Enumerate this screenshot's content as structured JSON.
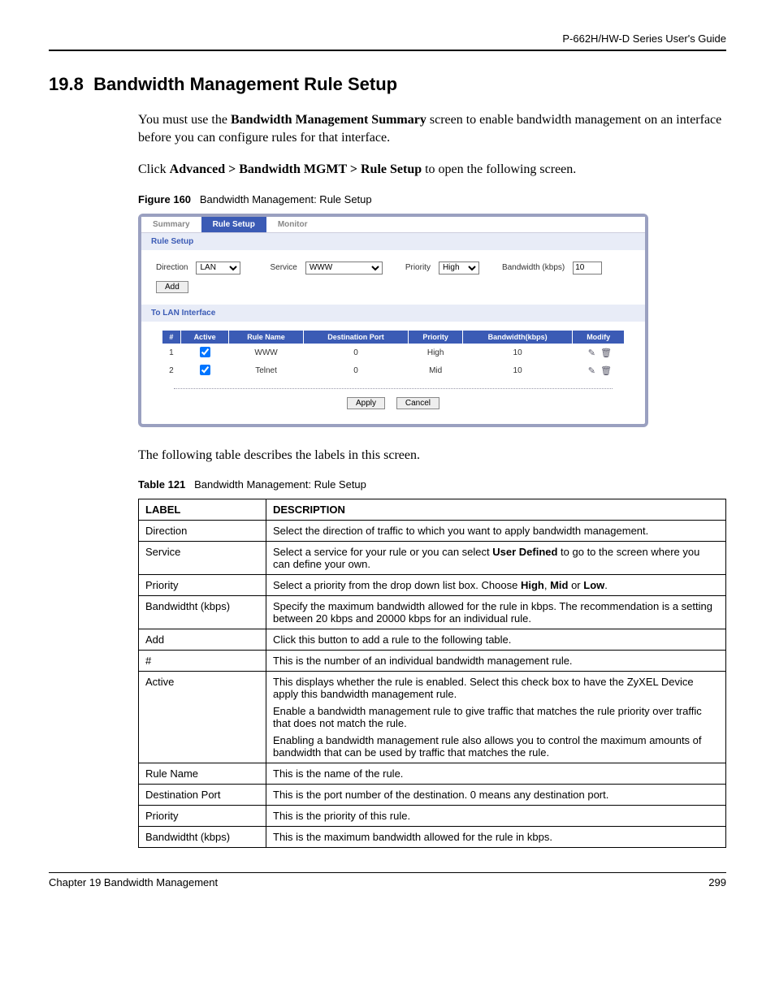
{
  "header": {
    "guide": "P-662H/HW-D Series User's Guide"
  },
  "section": {
    "number": "19.8",
    "title": "Bandwidth Management Rule Setup"
  },
  "intro": {
    "p1_a": "You must use the ",
    "p1_b": "Bandwidth Management Summary",
    "p1_c": " screen to enable bandwidth management on an interface before you can configure rules for that interface.",
    "p2_a": "Click ",
    "p2_b": "Advanced > Bandwidth MGMT > Rule Setup",
    "p2_c": " to open the following screen."
  },
  "figure": {
    "label": "Figure 160",
    "title": "Bandwidth Management: Rule Setup"
  },
  "screenshot": {
    "tabs": {
      "summary": "Summary",
      "rule_setup": "Rule Setup",
      "monitor": "Monitor"
    },
    "panel1": "Rule Setup",
    "form": {
      "direction_label": "Direction",
      "direction_value": "LAN",
      "service_label": "Service",
      "service_value": "WWW",
      "priority_label": "Priority",
      "priority_value": "High",
      "bandwidth_label": "Bandwidth (kbps)",
      "bandwidth_value": "10",
      "add": "Add"
    },
    "panel2": "To LAN Interface",
    "cols": {
      "num": "#",
      "active": "Active",
      "rule": "Rule Name",
      "dport": "Destination Port",
      "priority": "Priority",
      "bw": "Bandwidth(kbps)",
      "modify": "Modify"
    },
    "rows": [
      {
        "num": "1",
        "active": true,
        "rule": "WWW",
        "dport": "0",
        "priority": "High",
        "bw": "10"
      },
      {
        "num": "2",
        "active": true,
        "rule": "Telnet",
        "dport": "0",
        "priority": "Mid",
        "bw": "10"
      }
    ],
    "apply": "Apply",
    "cancel": "Cancel"
  },
  "between": "The following table describes the labels in this screen.",
  "table_caption": {
    "label": "Table 121",
    "title": "Bandwidth Management: Rule Setup"
  },
  "desc": {
    "h_label": "LABEL",
    "h_desc": "DESCRIPTION",
    "rows": {
      "direction": {
        "l": "Direction",
        "d": "Select the direction of traffic to which you want to apply bandwidth management."
      },
      "service": {
        "l": "Service",
        "d_a": "Select a service for your rule or you can select ",
        "d_b": "User Defined",
        "d_c": " to go to the screen where you can define your own."
      },
      "priority": {
        "l": "Priority",
        "d_a": "Select a priority from the drop down list box. Choose ",
        "d_b": "High",
        "d_c": ", ",
        "d_d": "Mid",
        "d_e": " or ",
        "d_f": "Low",
        "d_g": "."
      },
      "bw": {
        "l": "Bandwidtht (kbps)",
        "d": "Specify the maximum bandwidth allowed for the rule in kbps. The recommendation is a setting between 20 kbps and 20000 kbps for an individual rule."
      },
      "add": {
        "l": "Add",
        "d": "Click this button to add a rule to the following table."
      },
      "num": {
        "l": "#",
        "d": "This is the number of an individual bandwidth management rule."
      },
      "active": {
        "l": "Active",
        "p1": "This displays whether the rule is enabled. Select this check box to have the ZyXEL Device apply this bandwidth management rule.",
        "p2": "Enable a bandwidth management rule to give traffic that matches the rule priority over traffic that does not match the rule.",
        "p3": "Enabling a bandwidth management rule also allows you to control the maximum amounts of bandwidth that can be used by traffic that matches the rule."
      },
      "rule": {
        "l": "Rule Name",
        "d": "This is the name of the rule."
      },
      "dport": {
        "l": "Destination Port",
        "d": "This is the port number of the destination. 0 means any destination port."
      },
      "priority2": {
        "l": "Priority",
        "d": "This is the priority of this rule."
      },
      "bw2": {
        "l": "Bandwidtht (kbps)",
        "d": "This is the maximum bandwidth allowed for the rule in kbps."
      }
    }
  },
  "footer": {
    "chapter": "Chapter 19 Bandwidth Management",
    "page": "299"
  }
}
